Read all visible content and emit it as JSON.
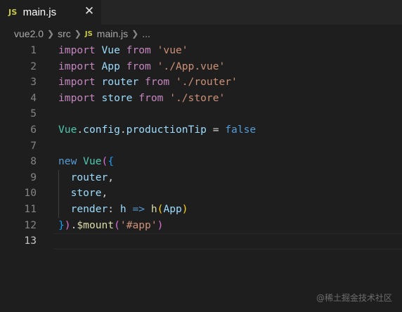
{
  "tab": {
    "badge": "JS",
    "label": "main.js",
    "close_glyph": "✕"
  },
  "breadcrumb": {
    "items": [
      "vue2.0",
      "src",
      "main.js",
      "..."
    ],
    "separator": "❯",
    "file_badge": "JS"
  },
  "code": {
    "line_numbers": [
      "1",
      "2",
      "3",
      "4",
      "5",
      "6",
      "7",
      "8",
      "9",
      "10",
      "11",
      "12",
      "13"
    ],
    "active_line": "13",
    "lines": [
      [
        {
          "t": "import",
          "c": "kw"
        },
        {
          "t": " ",
          "c": "plain"
        },
        {
          "t": "Vue",
          "c": "var"
        },
        {
          "t": " ",
          "c": "plain"
        },
        {
          "t": "from",
          "c": "kw"
        },
        {
          "t": " ",
          "c": "plain"
        },
        {
          "t": "'vue'",
          "c": "str"
        }
      ],
      [
        {
          "t": "import",
          "c": "kw"
        },
        {
          "t": " ",
          "c": "plain"
        },
        {
          "t": "App",
          "c": "var"
        },
        {
          "t": " ",
          "c": "plain"
        },
        {
          "t": "from",
          "c": "kw"
        },
        {
          "t": " ",
          "c": "plain"
        },
        {
          "t": "'./App.vue'",
          "c": "str"
        }
      ],
      [
        {
          "t": "import",
          "c": "kw"
        },
        {
          "t": " ",
          "c": "plain"
        },
        {
          "t": "router",
          "c": "var"
        },
        {
          "t": " ",
          "c": "plain"
        },
        {
          "t": "from",
          "c": "kw"
        },
        {
          "t": " ",
          "c": "plain"
        },
        {
          "t": "'./router'",
          "c": "str"
        }
      ],
      [
        {
          "t": "import",
          "c": "kw"
        },
        {
          "t": " ",
          "c": "plain"
        },
        {
          "t": "store",
          "c": "var"
        },
        {
          "t": " ",
          "c": "plain"
        },
        {
          "t": "from",
          "c": "kw"
        },
        {
          "t": " ",
          "c": "plain"
        },
        {
          "t": "'./store'",
          "c": "str"
        }
      ],
      [],
      [
        {
          "t": "Vue",
          "c": "cls"
        },
        {
          "t": ".",
          "c": "plain"
        },
        {
          "t": "config",
          "c": "var"
        },
        {
          "t": ".",
          "c": "plain"
        },
        {
          "t": "productionTip",
          "c": "var"
        },
        {
          "t": " = ",
          "c": "plain"
        },
        {
          "t": "false",
          "c": "kb"
        }
      ],
      [],
      [
        {
          "t": "new",
          "c": "kb"
        },
        {
          "t": " ",
          "c": "plain"
        },
        {
          "t": "Vue",
          "c": "cls"
        },
        {
          "t": "(",
          "c": "br1"
        },
        {
          "t": "{",
          "c": "br2"
        }
      ],
      [
        {
          "t": "  ",
          "c": "plain"
        },
        {
          "t": "router",
          "c": "var"
        },
        {
          "t": ",",
          "c": "plain"
        }
      ],
      [
        {
          "t": "  ",
          "c": "plain"
        },
        {
          "t": "store",
          "c": "var"
        },
        {
          "t": ",",
          "c": "plain"
        }
      ],
      [
        {
          "t": "  ",
          "c": "plain"
        },
        {
          "t": "render",
          "c": "var"
        },
        {
          "t": ": ",
          "c": "plain"
        },
        {
          "t": "h",
          "c": "var"
        },
        {
          "t": " ",
          "c": "plain"
        },
        {
          "t": "=>",
          "c": "kb"
        },
        {
          "t": " ",
          "c": "plain"
        },
        {
          "t": "h",
          "c": "fn"
        },
        {
          "t": "(",
          "c": "br0"
        },
        {
          "t": "App",
          "c": "var"
        },
        {
          "t": ")",
          "c": "br0"
        }
      ],
      [
        {
          "t": "}",
          "c": "br2"
        },
        {
          "t": ")",
          "c": "br1"
        },
        {
          "t": ".",
          "c": "plain"
        },
        {
          "t": "$mount",
          "c": "fn"
        },
        {
          "t": "(",
          "c": "br1"
        },
        {
          "t": "'#app'",
          "c": "str"
        },
        {
          "t": ")",
          "c": "br1"
        }
      ],
      []
    ]
  },
  "watermark": "@稀土掘金技术社区",
  "colors": {
    "editor_bg": "#1e1e1e",
    "tabbar_bg": "#252526",
    "keyword_control": "#c586c0",
    "keyword": "#569cd6",
    "variable": "#9cdcfe",
    "string": "#ce9178",
    "class": "#4ec9b0",
    "function": "#dcdcaa",
    "js_badge": "#cbcb41"
  }
}
